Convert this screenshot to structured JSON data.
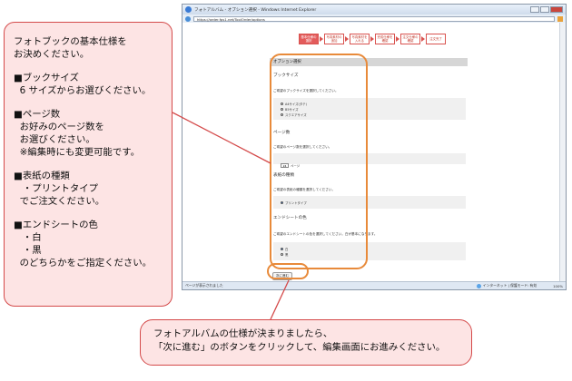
{
  "left_callout": {
    "intro": "フォトブックの基本仕様を\nお決めください。",
    "sections": [
      {
        "title": "■ブックサイズ",
        "lines": [
          "  6 サイズからお選びください。"
        ]
      },
      {
        "title": "■ページ数",
        "lines": [
          "  お好みのページ数を",
          "  お選びください。",
          "  ※編集時にも変更可能です。"
        ]
      },
      {
        "title": "■表紙の種類",
        "lines": [
          "   ・プリントタイプ",
          "  でご注文ください。"
        ]
      },
      {
        "title": "■エンドシートの色",
        "lines": [
          "   ・白",
          "   ・黒",
          "  のどちらかをご指定ください。"
        ]
      }
    ]
  },
  "bottom_callout": {
    "line1": "フォトアルバムの仕様が決まりましたら、",
    "line2": "「次に進む」のボタンをクリックして、編集画面にお進みください。"
  },
  "browser": {
    "title": "フォトアルバム - オプション選択 - Windows Internet Explorer",
    "url": "https://order.fps1.net/ToolOrder/options",
    "steps": [
      {
        "label": "基本仕様の選択",
        "active": true
      },
      {
        "label": "写真素材の追加",
        "active": false
      },
      {
        "label": "写真素材を入れる",
        "active": false
      },
      {
        "label": "完成仕様を確認",
        "active": false
      },
      {
        "label": "注文仕様の確認",
        "active": false
      },
      {
        "label": "注文完了",
        "active": false
      }
    ],
    "section_header": "オプション選択",
    "book_size": {
      "title": "ブックサイズ",
      "desc": "ご希望のブックサイズを選択してください。",
      "options": [
        "A4サイズ(タテ)",
        "B5サイズ",
        "スクエアサイズ"
      ]
    },
    "page_count": {
      "title": "ページ数",
      "desc": "ご希望のページ数を選択してください。",
      "value": "24",
      "unit": "ページ"
    },
    "cover": {
      "title": "表紙の種類",
      "desc": "ご希望の表紙の種類を選択してください。",
      "option": "プリントタイプ"
    },
    "endsheet": {
      "title": "エンドシートの色",
      "desc": "ご希望のエンドシートの色を選択してください。白が基本になります。",
      "options": [
        "白",
        "黒"
      ]
    },
    "next_button": "次に進む",
    "status_left": "ページが表示されました",
    "status_zone": "インターネット | 保護モード: 有効",
    "zoom": "100%"
  }
}
